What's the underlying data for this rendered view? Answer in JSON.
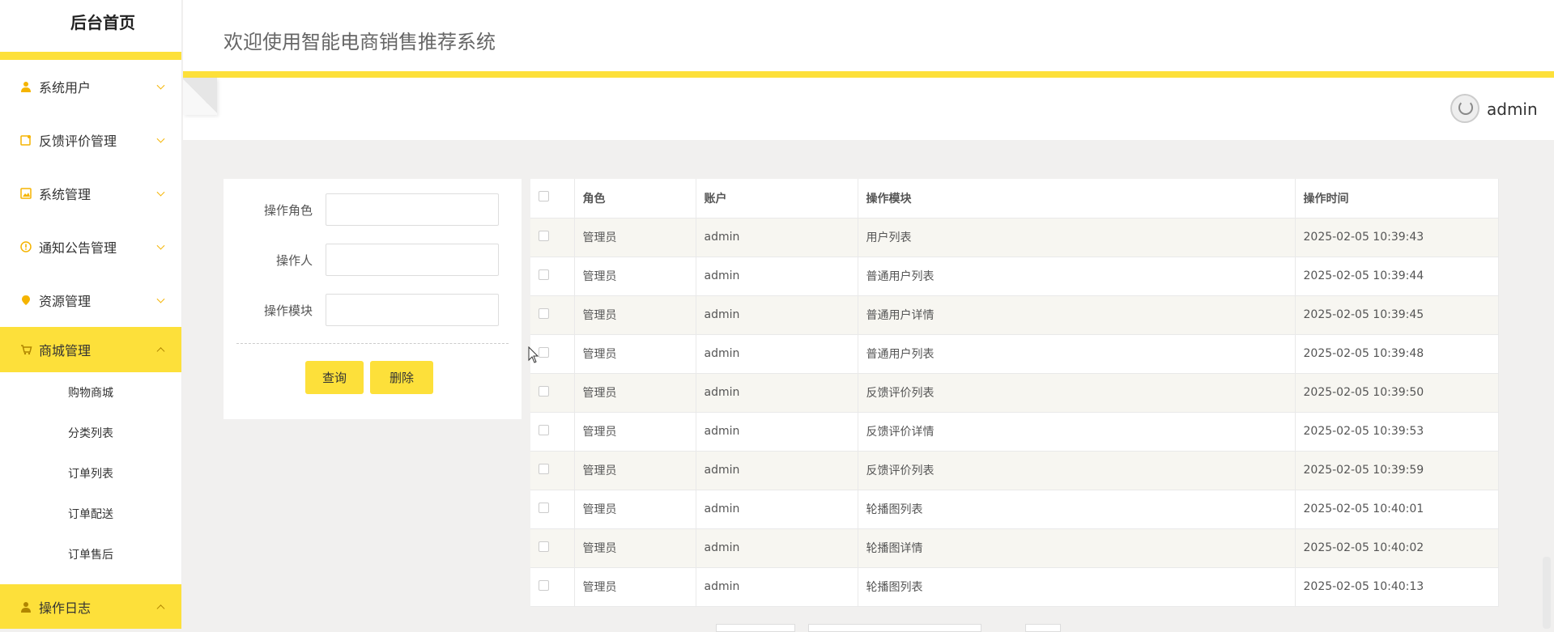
{
  "sidebar": {
    "title": "后台首页",
    "items": [
      {
        "label": "系统用户",
        "icon": "user-icon"
      },
      {
        "label": "反馈评价管理",
        "icon": "feedback-icon"
      },
      {
        "label": "系统管理",
        "icon": "image-icon"
      },
      {
        "label": "通知公告管理",
        "icon": "alert-icon"
      },
      {
        "label": "资源管理",
        "icon": "location-pin-icon"
      },
      {
        "label": "商城管理",
        "icon": "cart-icon",
        "active": true
      },
      {
        "label": "操作日志",
        "icon": "user-icon",
        "active": true
      }
    ],
    "sub_items": [
      "购物商城",
      "分类列表",
      "订单列表",
      "订单配送",
      "订单售后"
    ]
  },
  "header": {
    "title": "欢迎使用智能电商销售推荐系统",
    "username": "admin"
  },
  "search": {
    "fields": [
      {
        "label": "操作角色",
        "value": ""
      },
      {
        "label": "操作人",
        "value": ""
      },
      {
        "label": "操作模块",
        "value": ""
      }
    ],
    "query_label": "查询",
    "delete_label": "删除"
  },
  "table": {
    "columns": [
      "角色",
      "账户",
      "操作模块",
      "操作时间"
    ],
    "rows": [
      [
        "管理员",
        "admin",
        "用户列表",
        "2025-02-05 10:39:43"
      ],
      [
        "管理员",
        "admin",
        "普通用户列表",
        "2025-02-05 10:39:44"
      ],
      [
        "管理员",
        "admin",
        "普通用户详情",
        "2025-02-05 10:39:45"
      ],
      [
        "管理员",
        "admin",
        "普通用户列表",
        "2025-02-05 10:39:48"
      ],
      [
        "管理员",
        "admin",
        "反馈评价列表",
        "2025-02-05 10:39:50"
      ],
      [
        "管理员",
        "admin",
        "反馈评价详情",
        "2025-02-05 10:39:53"
      ],
      [
        "管理员",
        "admin",
        "反馈评价列表",
        "2025-02-05 10:39:59"
      ],
      [
        "管理员",
        "admin",
        "轮播图列表",
        "2025-02-05 10:40:01"
      ],
      [
        "管理员",
        "admin",
        "轮播图详情",
        "2025-02-05 10:40:02"
      ],
      [
        "管理员",
        "admin",
        "轮播图列表",
        "2025-02-05 10:40:13"
      ]
    ]
  },
  "colors": {
    "accent": "#fde03a",
    "icon": "#f5b400",
    "background": "#f1f0ef"
  }
}
